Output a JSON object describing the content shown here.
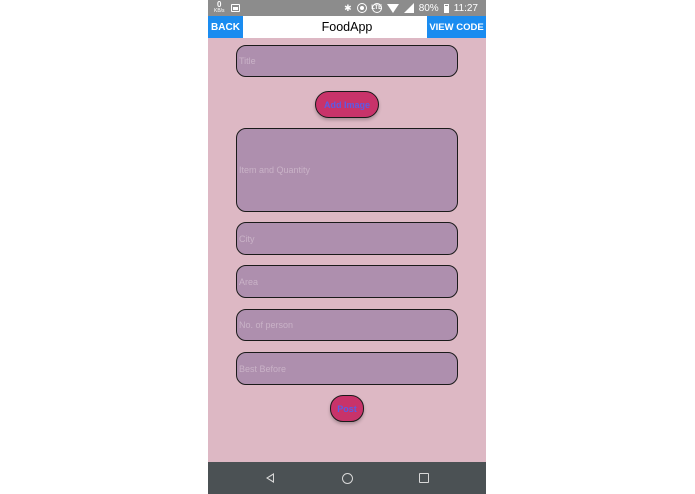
{
  "status_bar": {
    "net_speed_value": "0",
    "net_speed_unit": "KB/s",
    "lte_label": "LTE",
    "battery": "80%",
    "time": "11:27",
    "icons": [
      "gallery-icon",
      "bluetooth-icon",
      "target-icon",
      "lte-icon",
      "wifi-icon",
      "signal-icon",
      "battery-icon"
    ]
  },
  "header": {
    "back_label": "BACK",
    "title": "FoodApp",
    "view_code_label": "VIEW CODE",
    "accent_color": "#1a8cf0"
  },
  "form": {
    "title_placeholder": "Title",
    "add_image_label": "Add Image",
    "items_placeholder": "Item and Quantity",
    "city_placeholder": "City",
    "area_placeholder": "Area",
    "persons_placeholder": "No. of person",
    "best_before_placeholder": "Best Before",
    "post_label": "Post",
    "field_color": "#ae8fae",
    "button_color": "#c8336a",
    "background_color": "#ddb8c4"
  },
  "nav_bar": {
    "icons": [
      "back-triangle-icon",
      "home-circle-icon",
      "recents-square-icon"
    ]
  }
}
